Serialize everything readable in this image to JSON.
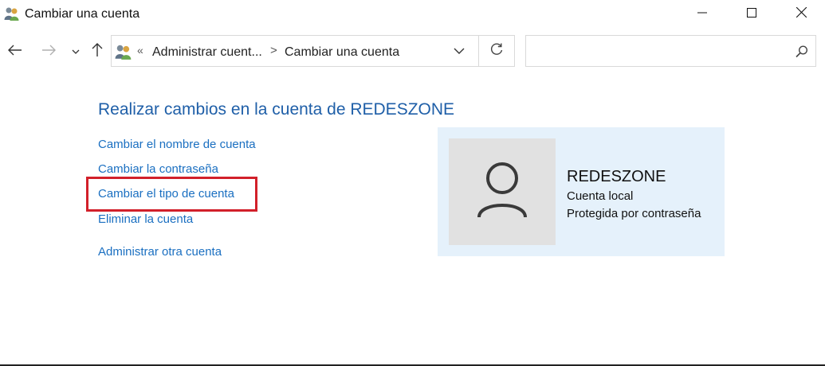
{
  "window": {
    "title": "Cambiar una cuenta",
    "app_icon": "users-icon",
    "controls": [
      "minimize-icon",
      "maximize-icon",
      "close-icon"
    ]
  },
  "navigation": {
    "back_icon": "arrow-left-icon",
    "forward_icon": "arrow-right-icon",
    "recent_icon": "chevron-down-icon",
    "up_icon": "arrow-up-icon"
  },
  "address_bar": {
    "overflow_chevron": "«",
    "breadcrumbs": [
      "Administrar cuent...",
      "Cambiar una cuenta"
    ],
    "separator": ">",
    "dropdown_icon": "chevron-down-icon",
    "refresh_icon": "refresh-icon"
  },
  "search": {
    "value": "",
    "placeholder": "",
    "icon": "search-icon"
  },
  "main": {
    "heading": "Realizar cambios en la cuenta de REDESZONE",
    "links": [
      "Cambiar el nombre de cuenta",
      "Cambiar la contraseña",
      "Cambiar el tipo de cuenta",
      "Eliminar la cuenta",
      "Administrar otra cuenta"
    ],
    "highlighted_link_index": 2
  },
  "account": {
    "name": "REDESZONE",
    "type": "Cuenta local",
    "status": "Protegida por contraseña",
    "avatar_icon": "user-avatar-icon"
  },
  "colors": {
    "link": "#1a6fc1",
    "heading": "#1f5fa8",
    "highlight": "#d2202a",
    "panel_bg": "#e5f1fb",
    "avatar_bg": "#e1e1e1"
  }
}
